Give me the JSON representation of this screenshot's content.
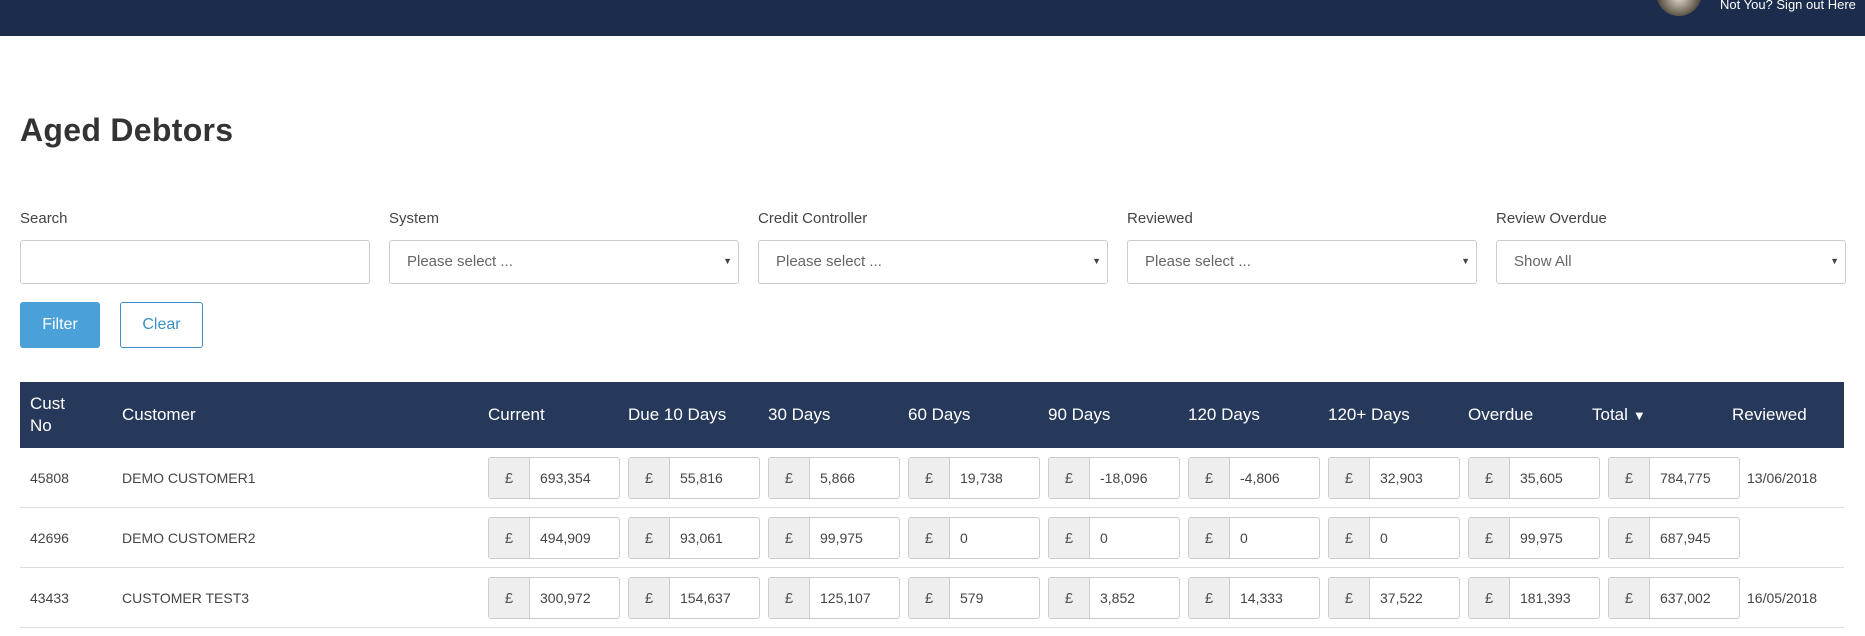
{
  "header": {
    "signout_text": "Not You? Sign out Here"
  },
  "page": {
    "title": "Aged Debtors"
  },
  "filters": {
    "search_label": "Search",
    "search_value": "",
    "system_label": "System",
    "system_value": "Please select ...",
    "credit_controller_label": "Credit Controller",
    "credit_controller_value": "Please select ...",
    "reviewed_label": "Reviewed",
    "reviewed_value": "Please select ...",
    "review_overdue_label": "Review Overdue",
    "review_overdue_value": "Show All",
    "filter_button": "Filter",
    "clear_button": "Clear"
  },
  "table": {
    "currency_symbol": "£",
    "columns": {
      "cust_no": "Cust No",
      "customer": "Customer",
      "current": "Current",
      "due10": "Due 10 Days",
      "d30": "30 Days",
      "d60": "60 Days",
      "d90": "90 Days",
      "d120": "120 Days",
      "d120plus": "120+ Days",
      "overdue": "Overdue",
      "total": "Total",
      "reviewed": "Reviewed"
    },
    "sort_indicator": "▼",
    "rows": [
      {
        "cust_no": "45808",
        "customer": "DEMO CUSTOMER1",
        "current": "693,354",
        "due10": "55,816",
        "d30": "5,866",
        "d60": "19,738",
        "d90": "-18,096",
        "d120": "-4,806",
        "d120plus": "32,903",
        "overdue": "35,605",
        "total": "784,775",
        "reviewed": "13/06/2018"
      },
      {
        "cust_no": "42696",
        "customer": "DEMO CUSTOMER2",
        "current": "494,909",
        "due10": "93,061",
        "d30": "99,975",
        "d60": "0",
        "d90": "0",
        "d120": "0",
        "d120plus": "0",
        "overdue": "99,975",
        "total": "687,945",
        "reviewed": ""
      },
      {
        "cust_no": "43433",
        "customer": "CUSTOMER TEST3",
        "current": "300,972",
        "due10": "154,637",
        "d30": "125,107",
        "d60": "579",
        "d90": "3,852",
        "d120": "14,333",
        "d120plus": "37,522",
        "overdue": "181,393",
        "total": "637,002",
        "reviewed": "16/05/2018"
      }
    ]
  },
  "colors": {
    "topbar": "#1b2c4c",
    "table_header": "#26395a",
    "primary_button": "#4aa0d8"
  }
}
